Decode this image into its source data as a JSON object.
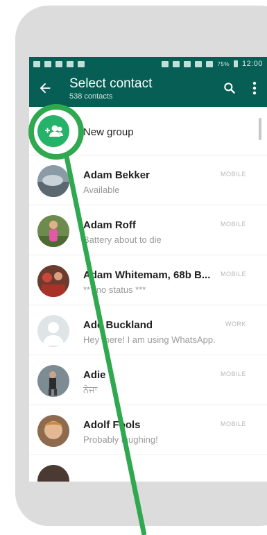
{
  "status_bar": {
    "battery": "75%",
    "time": "12:00"
  },
  "app_bar": {
    "title": "Select contact",
    "subtitle": "538 contacts"
  },
  "new_group": {
    "label": "New group"
  },
  "contacts": [
    {
      "name": "Adam Bekker",
      "status": "Available",
      "tag": "MOBILE"
    },
    {
      "name": "Adam Roff",
      "status": "Battery about to die",
      "tag": "MOBILE"
    },
    {
      "name": "Adam Whitemam, 68b B...",
      "status": "*** no status ***",
      "tag": "MOBILE"
    },
    {
      "name": "Ade Buckland",
      "status": "Hey there! I am using WhatsApp.",
      "tag": "WORK"
    },
    {
      "name": "Adie",
      "status": "ਨੇਜਾ",
      "tag": "MOBILE"
    },
    {
      "name": "Adolf Fools",
      "status": "Probably laughing!",
      "tag": "MOBILE"
    }
  ],
  "colors": {
    "toolbar": "#075e54",
    "accent_green": "#25b36a",
    "highlight": "#2fa84f",
    "card": "#dcdcdc"
  },
  "icons": {
    "back": "arrow-left-icon",
    "search": "search-icon",
    "menu": "more-vert-icon",
    "group": "group-add-icon"
  }
}
